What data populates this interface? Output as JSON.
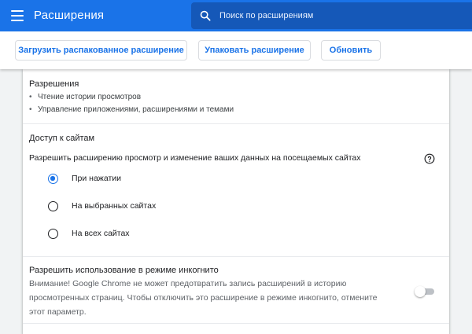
{
  "header": {
    "title": "Расширения",
    "menu_icon": "hamburger-menu-icon",
    "search": {
      "icon": "search-icon",
      "placeholder": "Поиск по расширениям",
      "value": ""
    }
  },
  "toolbar": {
    "load_unpacked_label": "Загрузить распакованное расширение",
    "pack_label": "Упаковать расширение",
    "update_label": "Обновить"
  },
  "permissions": {
    "heading": "Разрешения",
    "items": [
      "Чтение истории просмотров",
      "Управление приложениями, расширениями и темами"
    ]
  },
  "site_access": {
    "heading": "Доступ к сайтам",
    "description": "Разрешить расширению просмотр и изменение ваших данных на посещаемых сайтах",
    "help_icon": "help-circle-icon",
    "options": [
      {
        "label": "При нажатии",
        "checked": true
      },
      {
        "label": "На выбранных сайтах",
        "checked": false
      },
      {
        "label": "На всех сайтах",
        "checked": false
      }
    ]
  },
  "incognito": {
    "title": "Разрешить использование в режиме инкогнито",
    "warning": "Внимание! Google Chrome не может предотвратить запись расширений в историю просмотренных страниц. Чтобы отключить это расширение в режиме инкогнито, отмените этот параметр.",
    "enabled": false
  },
  "colors": {
    "accent": "#1a73e8",
    "header_bg": "#1a73e8",
    "search_bg": "#1558b8",
    "page_bg": "#f1f3f4"
  }
}
